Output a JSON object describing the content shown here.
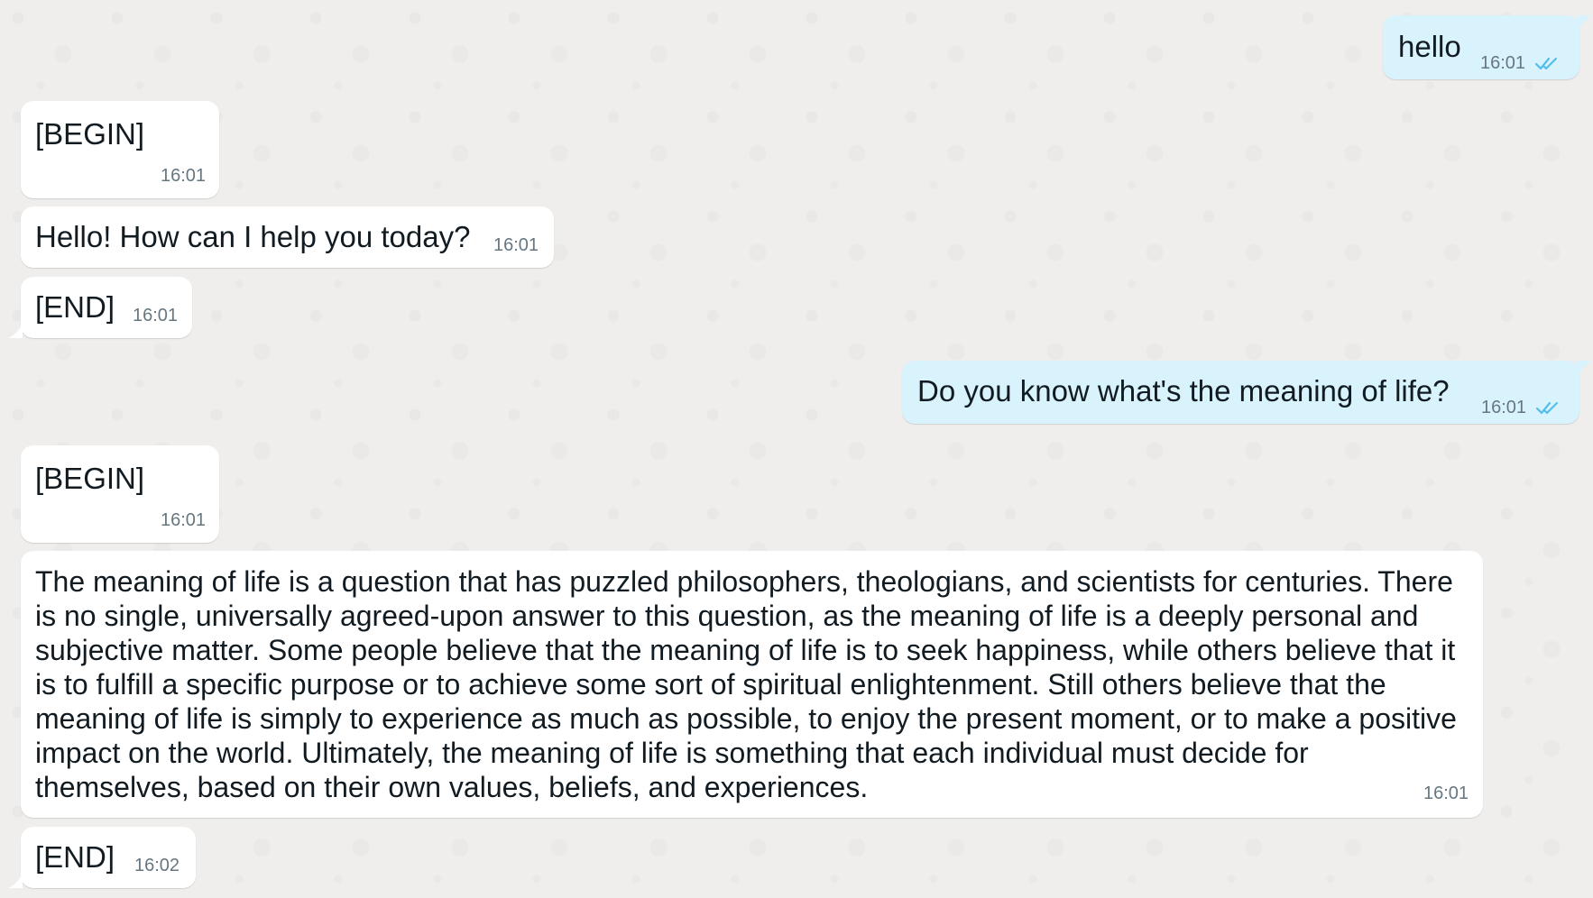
{
  "colors": {
    "background": "#efeeec",
    "incoming_bubble": "#ffffff",
    "outgoing_bubble": "#d9f3fd",
    "timestamp": "#667781",
    "read_ticks": "#53bdeb"
  },
  "messages": [
    {
      "direction": "outgoing",
      "text": "hello",
      "time": "16:01",
      "status_icon": "double-check-icon"
    },
    {
      "direction": "incoming",
      "text": "[BEGIN]",
      "time": "16:01"
    },
    {
      "direction": "incoming",
      "text": "Hello! How can I help you today?",
      "time": "16:01"
    },
    {
      "direction": "incoming",
      "text": "[END]",
      "time": "16:01"
    },
    {
      "direction": "outgoing",
      "text": "Do you know what's the meaning of life?",
      "time": "16:01",
      "status_icon": "double-check-icon"
    },
    {
      "direction": "incoming",
      "text": "[BEGIN]",
      "time": "16:01"
    },
    {
      "direction": "incoming",
      "text": "The meaning of life is a question that has puzzled philosophers, theologians, and scientists for centuries. There is no single, universally agreed-upon answer to this question, as the meaning of life is a deeply personal and subjective matter. Some people believe that the meaning of life is to seek happiness, while others believe that it is to fulfill a specific purpose or to achieve some sort of spiritual enlightenment. Still others believe that the meaning of life is simply to experience as much as possible, to enjoy the present moment, or to make a positive impact on the world. Ultimately, the meaning of life is something that each individual must decide for themselves, based on their own values, beliefs, and experiences.",
      "time": "16:01"
    },
    {
      "direction": "incoming",
      "text": "[END]",
      "time": "16:02"
    }
  ]
}
